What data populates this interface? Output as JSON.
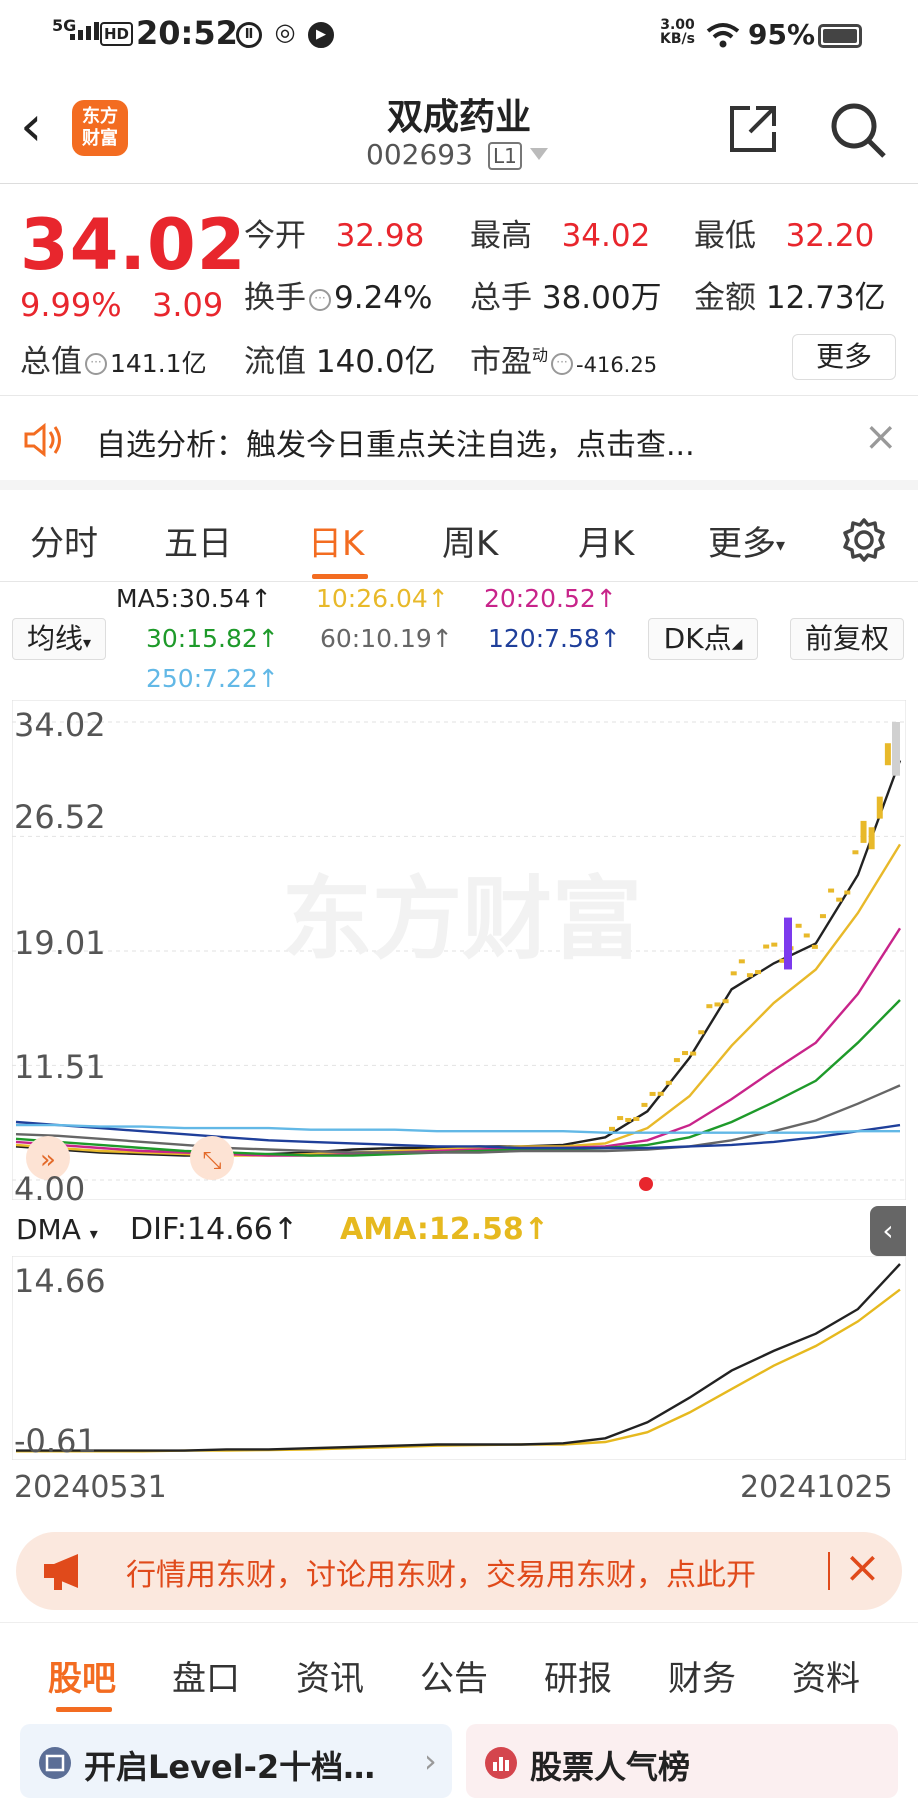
{
  "status": {
    "network": "5G",
    "hd": "HD",
    "time": "20:52",
    "speed_value": "3.00",
    "speed_unit": "KB/s",
    "battery": "95%"
  },
  "header": {
    "logo_line1": "东方",
    "logo_line2": "财富",
    "title": "双成药业",
    "code": "002693",
    "level": "L1"
  },
  "quote": {
    "price": "34.02",
    "change_pct": "9.99%",
    "change": "3.09",
    "open_label": "今开",
    "open": "32.98",
    "high_label": "最高",
    "high": "34.02",
    "low_label": "最低",
    "low": "32.20",
    "turnover_label": "换手",
    "turnover": "9.24%",
    "volume_label": "总手",
    "volume": "38.00万",
    "amount_label": "金额",
    "amount": "12.73亿",
    "mcap_label": "总值",
    "mcap": "141.1亿",
    "float_label": "流值",
    "float": "140.0亿",
    "pe_label": "市盈",
    "pe_sup": "动",
    "pe": "-416.25",
    "more": "更多"
  },
  "notice": {
    "text": "自选分析：触发今日重点关注自选，点击查..."
  },
  "tabs": [
    "分时",
    "五日",
    "日K",
    "周K",
    "月K",
    "更多"
  ],
  "active_tab": "日K",
  "ma": {
    "ma5": "MA5:30.54↑",
    "ma10": "10:26.04↑",
    "ma20": "20:20.52↑",
    "ma30": "30:15.82↑",
    "ma60": "60:10.19↑",
    "ma120": "120:7.58↑",
    "ma250": "250:7.22↑",
    "colors": {
      "ma5": "#222222",
      "ma10": "#e8b92a",
      "ma20": "#c8248a",
      "ma30": "#1e9a2a",
      "ma60": "#666666",
      "ma120": "#1f3f9a",
      "ma250": "#62b8e6"
    },
    "junxian": "均线",
    "dk": "DK点",
    "fq": "前复权"
  },
  "chart_data": {
    "type": "line",
    "title": "",
    "x_start": "20240531",
    "x_end": "20241025",
    "ylim": [
      4.0,
      34.02
    ],
    "y_ticks": [
      "34.02",
      "26.52",
      "19.01",
      "11.51",
      "4.00"
    ],
    "series": [
      {
        "name": "MA5",
        "values": [
          6.2,
          6.0,
          5.8,
          5.7,
          5.6,
          5.6,
          5.7,
          5.8,
          6.0,
          6.1,
          6.1,
          6.2,
          6.2,
          6.3,
          6.8,
          8.5,
          12.0,
          16.5,
          18.2,
          19.5,
          24.0,
          31.5
        ]
      },
      {
        "name": "MA10",
        "values": [
          6.3,
          6.1,
          5.9,
          5.8,
          5.7,
          5.6,
          5.6,
          5.7,
          5.8,
          5.9,
          6.0,
          6.1,
          6.2,
          6.2,
          6.4,
          7.4,
          9.5,
          12.8,
          15.6,
          17.8,
          21.5,
          26.0
        ]
      },
      {
        "name": "MA20",
        "values": [
          6.5,
          6.3,
          6.1,
          5.9,
          5.8,
          5.7,
          5.6,
          5.6,
          5.7,
          5.8,
          5.9,
          6.0,
          6.1,
          6.1,
          6.2,
          6.6,
          7.6,
          9.3,
          11.2,
          13.0,
          16.2,
          20.5
        ]
      },
      {
        "name": "MA30",
        "values": [
          6.7,
          6.5,
          6.3,
          6.1,
          5.9,
          5.8,
          5.7,
          5.6,
          5.6,
          5.7,
          5.8,
          5.9,
          6.0,
          6.0,
          6.1,
          6.3,
          6.8,
          7.8,
          9.1,
          10.5,
          13.0,
          15.8
        ]
      },
      {
        "name": "MA60",
        "values": [
          7.0,
          6.9,
          6.7,
          6.5,
          6.3,
          6.1,
          6.0,
          5.9,
          5.8,
          5.8,
          5.8,
          5.8,
          5.9,
          5.9,
          5.9,
          6.0,
          6.2,
          6.6,
          7.2,
          7.9,
          9.0,
          10.2
        ]
      },
      {
        "name": "MA120",
        "values": [
          7.8,
          7.6,
          7.4,
          7.2,
          7.0,
          6.8,
          6.6,
          6.5,
          6.4,
          6.3,
          6.2,
          6.2,
          6.1,
          6.1,
          6.1,
          6.1,
          6.2,
          6.3,
          6.5,
          6.8,
          7.2,
          7.6
        ]
      },
      {
        "name": "MA250",
        "values": [
          7.6,
          7.6,
          7.5,
          7.5,
          7.4,
          7.4,
          7.4,
          7.3,
          7.3,
          7.3,
          7.2,
          7.2,
          7.2,
          7.2,
          7.1,
          7.1,
          7.1,
          7.1,
          7.1,
          7.1,
          7.2,
          7.2
        ]
      }
    ]
  },
  "dma": {
    "label": "DMA",
    "dif": "DIF:14.66↑",
    "ama": "AMA:12.58↑",
    "y_ticks": [
      "14.66",
      "-0.61"
    ],
    "ylim": [
      -0.61,
      14.66
    ],
    "dif_values": [
      -0.5,
      -0.5,
      -0.5,
      -0.5,
      -0.5,
      -0.4,
      -0.4,
      -0.3,
      -0.2,
      -0.1,
      0.0,
      0.0,
      0.0,
      0.1,
      0.5,
      1.8,
      3.8,
      6.0,
      7.6,
      9.0,
      11.0,
      14.66
    ],
    "ama_values": [
      -0.55,
      -0.55,
      -0.55,
      -0.55,
      -0.5,
      -0.5,
      -0.45,
      -0.4,
      -0.3,
      -0.2,
      -0.1,
      -0.05,
      0.0,
      0.0,
      0.2,
      1.0,
      2.6,
      4.5,
      6.4,
      8.0,
      10.0,
      12.58
    ]
  },
  "notice2": {
    "text": "行情用东财，讨论用东财，交易用东财，点此开"
  },
  "bottom_tabs": [
    "股吧",
    "盘口",
    "资讯",
    "公告",
    "研报",
    "财务",
    "资料"
  ],
  "cards": {
    "left": "开启Level-2十档…",
    "right": "股票人气榜"
  },
  "watermark": "东方财富"
}
